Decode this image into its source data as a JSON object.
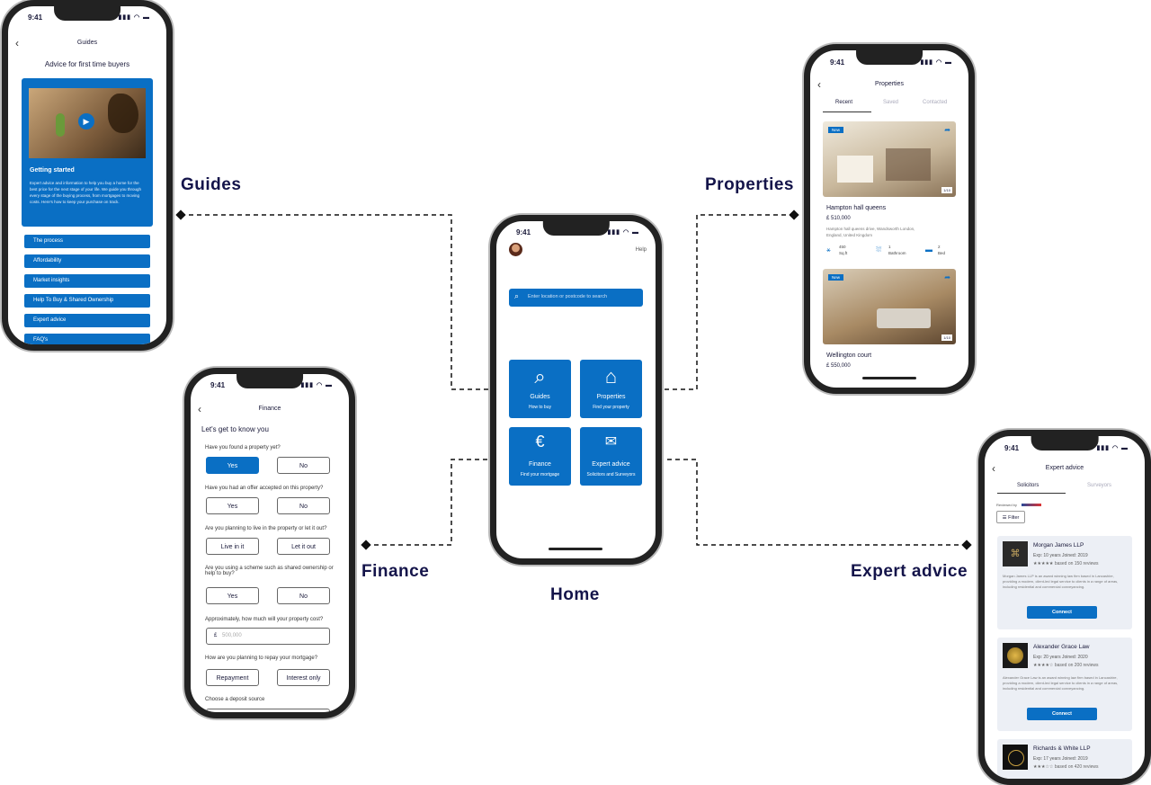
{
  "status_time": "9:41",
  "labels": {
    "guides": "Guides",
    "properties": "Properties",
    "finance": "Finance",
    "expert_advice": "Expert advice",
    "home": "Home"
  },
  "home": {
    "help": "Help",
    "search_placeholder": "Enter location or postcode to search",
    "tiles": [
      {
        "title": "Guides",
        "subtitle": "How to buy"
      },
      {
        "title": "Properties",
        "subtitle": "Find your property"
      },
      {
        "title": "Finance",
        "subtitle": "Find your mortgage"
      },
      {
        "title": "Expert advice",
        "subtitle": "Solicitors and Surveyors"
      }
    ]
  },
  "guides": {
    "header": "Guides",
    "heading": "Advice for first time buyers",
    "card_title": "Getting started",
    "card_text": "Expert advice and information to help you buy a home for the best price for the next stage of your life. We guide you through every stage of the buying process, from mortgages to moving costs. Here's how to keep your purchase on track.",
    "items": [
      "The process",
      "Affordability",
      "Market insights",
      "Help To Buy & Shared Ownership",
      "Expert advice",
      "FAQ's"
    ]
  },
  "properties": {
    "header": "Properties",
    "tabs": [
      "Recent",
      "Saved",
      "Contacted"
    ],
    "listings": [
      {
        "badge": "New",
        "counter": "1/10",
        "name": "Hampton hall queens",
        "price": "£  510,000",
        "address": "Hampton hall queens drive, Wandsworth London, England,  United Kingdom",
        "area_value": "450",
        "area_unit": "Sq.ft",
        "bath_value": "1",
        "bath_unit": "Bathroom",
        "bed_value": "2",
        "bed_unit": "Bed"
      },
      {
        "badge": "New",
        "counter": "1/10",
        "name": "Wellington court",
        "price": "£  550,000"
      }
    ]
  },
  "finance": {
    "header": "Finance",
    "heading": "Let's get to know you",
    "questions": [
      {
        "q": "Have you found a property yet?",
        "a": "Yes",
        "b": "No"
      },
      {
        "q": "Have you had an offer accepted on this property?",
        "a": "Yes",
        "b": "No"
      },
      {
        "q": "Are you planning to live in the property or let it out?",
        "a": "Live in it",
        "b": "Let it out"
      },
      {
        "q": "Are you using a scheme such as shared ownership or help to buy?",
        "a": "Yes",
        "b": "No"
      }
    ],
    "price_question": "Approximately, how much will your property cost?",
    "price_currency": "£",
    "price_placeholder": "500,000",
    "repay_question": "How are you planning to repay your mortgage?",
    "repay_a": "Repayment",
    "repay_b": "Interest only",
    "deposit_question": "Choose a deposit source"
  },
  "expert": {
    "header": "Expert advice",
    "tabs": [
      "Solicitors",
      "Surveyors"
    ],
    "reviewed_by": "Reviewed by",
    "filter": "Filter",
    "connect": "Connect",
    "firms": [
      {
        "name": "Morgan James LLP",
        "meta": "Exp: 10 years   Joined: 2019",
        "stars": "★★★★★",
        "reviews": "based on 150 reviews",
        "text": "Morgan James LLP is an award winning law firm based in Lancashire, providing a modern, client-led legal service to clients in a range of areas, including residential and commercial conveyancing."
      },
      {
        "name": "Alexander Grace Law",
        "meta": "Exp: 20 years   Joined: 2020",
        "stars": "★★★★☆",
        "reviews": "based on 200 reviews",
        "text": "Alexander Grace Law is an award winning law firm based in Lancashire, providing a modern, client-led legal service to clients in a range of areas, including residential and commercial conveyancing."
      },
      {
        "name": "Richards & White LLP",
        "meta": "Exp: 17 years   Joined: 2019",
        "stars": "★★★☆☆",
        "reviews": "based on 420 reviews"
      }
    ]
  },
  "colors": {
    "brand_blue": "#0a6fc4",
    "label_navy": "#14144a"
  }
}
